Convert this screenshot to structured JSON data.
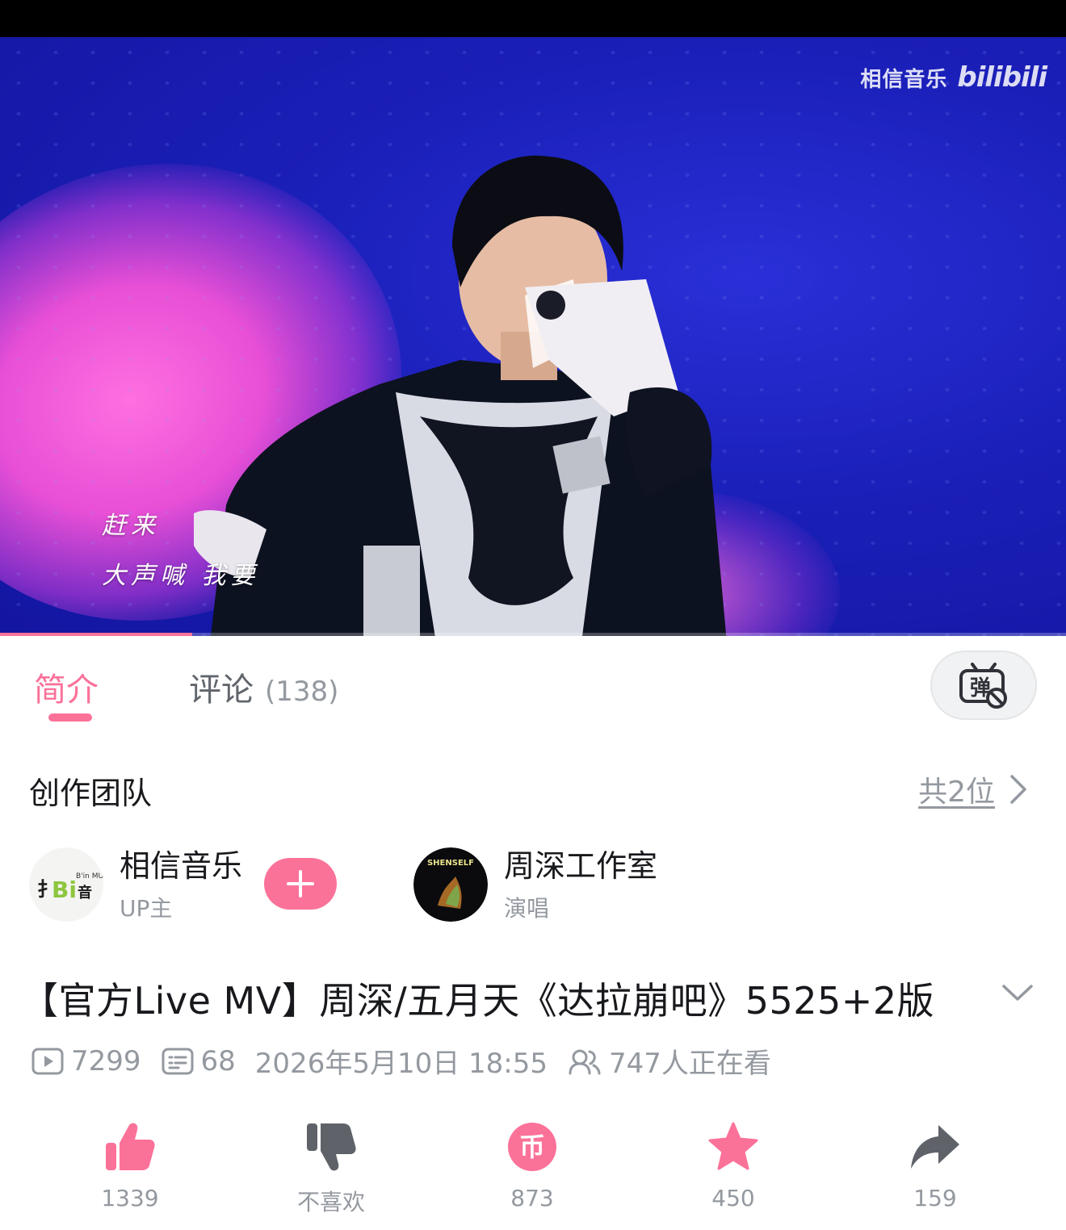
{
  "video": {
    "watermark_text": "相信音乐",
    "watermark_logo": "bilibili",
    "lyrics": [
      "赶来",
      "大声喊 我要"
    ],
    "progress_fraction": 0.18
  },
  "tabs": {
    "intro": "简介",
    "comments": "评论",
    "comments_count": "(138)",
    "danmaku_icon": "danmaku-off-icon"
  },
  "team": {
    "header": "创作团队",
    "count": "共2位",
    "members": [
      {
        "name": "相信音乐",
        "role": "UP主",
        "avatar_text": "B'in MUSIC"
      },
      {
        "name": "周深工作室",
        "role": "演唱",
        "avatar_text": "SHENSELF"
      }
    ]
  },
  "video_info": {
    "title": "【官方Live MV】周深/五月天《达拉崩吧》5525+2版",
    "views": "7299",
    "danmaku": "68",
    "date": "2026年5月10日 18:55",
    "watching": "747人正在看"
  },
  "actions": {
    "like": "1339",
    "dislike": "不喜欢",
    "coin": "873",
    "favorite": "450",
    "share": "159"
  },
  "colors": {
    "accent": "#fb7299",
    "muted": "#9499a0",
    "text": "#18191c"
  }
}
